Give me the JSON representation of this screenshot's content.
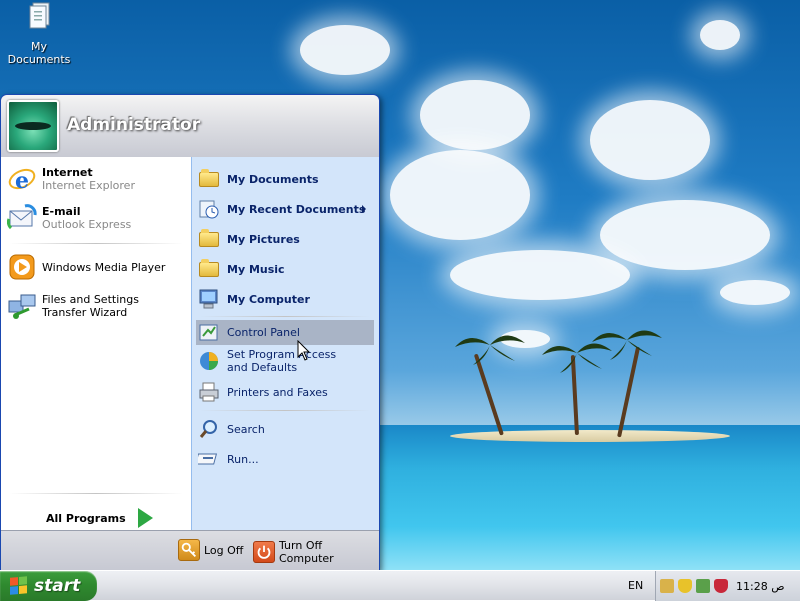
{
  "desktop": {
    "icons": [
      {
        "label": "My Documents",
        "icon": "my-documents-icon"
      }
    ]
  },
  "start_menu": {
    "username": "Administrator",
    "left": {
      "pinned": [
        {
          "title": "Internet",
          "subtitle": "Internet Explorer",
          "icon": "internet-explorer-icon"
        },
        {
          "title": "E-mail",
          "subtitle": "Outlook Express",
          "icon": "outlook-express-icon"
        }
      ],
      "recent": [
        {
          "title": "Windows Media Player",
          "icon": "media-player-icon"
        },
        {
          "title": "Files and Settings Transfer Wizard",
          "icon": "transfer-wizard-icon"
        }
      ],
      "all_programs": "All Programs"
    },
    "right": {
      "items": [
        {
          "label": "My Documents",
          "icon": "folder-documents-icon"
        },
        {
          "label": "My Recent Documents",
          "icon": "recent-documents-icon"
        },
        {
          "label": "My Pictures",
          "icon": "folder-pictures-icon"
        },
        {
          "label": "My Music",
          "icon": "folder-music-icon"
        },
        {
          "label": "My Computer",
          "icon": "computer-icon"
        },
        {
          "label": "Control Panel",
          "icon": "control-panel-icon"
        },
        {
          "label": "Set Program Access and Defaults",
          "icon": "program-access-icon"
        },
        {
          "label": "Printers and Faxes",
          "icon": "printer-icon"
        },
        {
          "label": "Search",
          "icon": "search-icon"
        },
        {
          "label": "Run...",
          "icon": "run-icon"
        }
      ]
    },
    "footer": {
      "log_off": "Log Off",
      "turn_off": "Turn Off Computer"
    }
  },
  "taskbar": {
    "start_label": "start",
    "language": "EN",
    "clock": "11:28 ص"
  },
  "colors": {
    "start_green": "#2f8a2f",
    "menu_blue": "#1b5ccc",
    "right_pane": "#d3e5fa",
    "highlight": "#a9b4c6"
  }
}
